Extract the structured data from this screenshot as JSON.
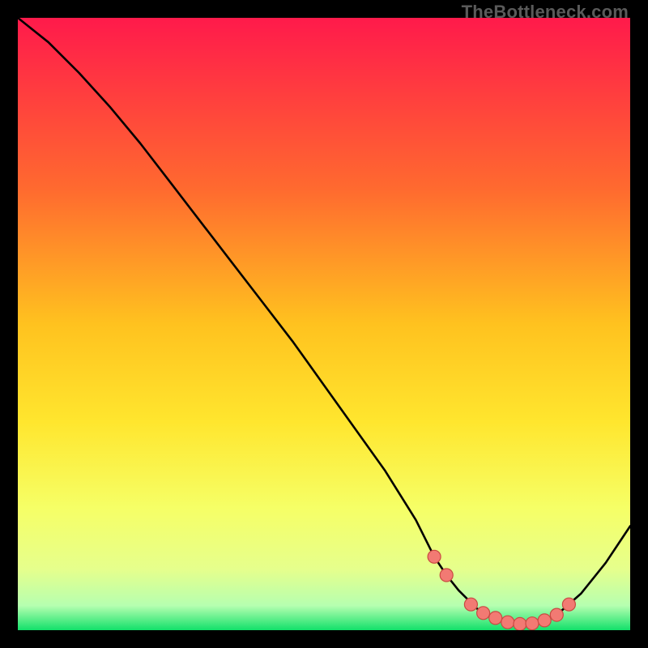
{
  "watermark": "TheBottleneck.com",
  "colors": {
    "gradient_top": "#ff1a4b",
    "gradient_upper_mid": "#ff8a2a",
    "gradient_mid": "#ffe62e",
    "gradient_lower_mid": "#f6ff66",
    "gradient_low": "#d7ffa0",
    "gradient_bottom": "#12e06a",
    "curve": "#000000",
    "marker_fill": "#f27a73",
    "marker_stroke": "#c94a42"
  },
  "chart_data": {
    "type": "line",
    "title": "",
    "xlabel": "",
    "ylabel": "",
    "x": [
      0,
      5,
      10,
      15,
      20,
      25,
      30,
      35,
      40,
      45,
      50,
      55,
      60,
      65,
      68,
      70,
      72,
      75,
      78,
      80,
      82,
      85,
      88,
      92,
      96,
      100
    ],
    "values": [
      100,
      96,
      91,
      85.5,
      79.5,
      73,
      66.5,
      60,
      53.5,
      47,
      40,
      33,
      26,
      18,
      12,
      9,
      6.5,
      3.5,
      2,
      1.3,
      1.0,
      1.2,
      2.5,
      6,
      11,
      17
    ],
    "xlim": [
      0,
      100
    ],
    "ylim": [
      0,
      100
    ],
    "markers": {
      "x": [
        68,
        70,
        74,
        76,
        78,
        80,
        82,
        84,
        86,
        88,
        90
      ],
      "y": [
        12,
        9,
        4.2,
        2.8,
        2.0,
        1.3,
        1.0,
        1.1,
        1.6,
        2.5,
        4.2
      ]
    }
  }
}
